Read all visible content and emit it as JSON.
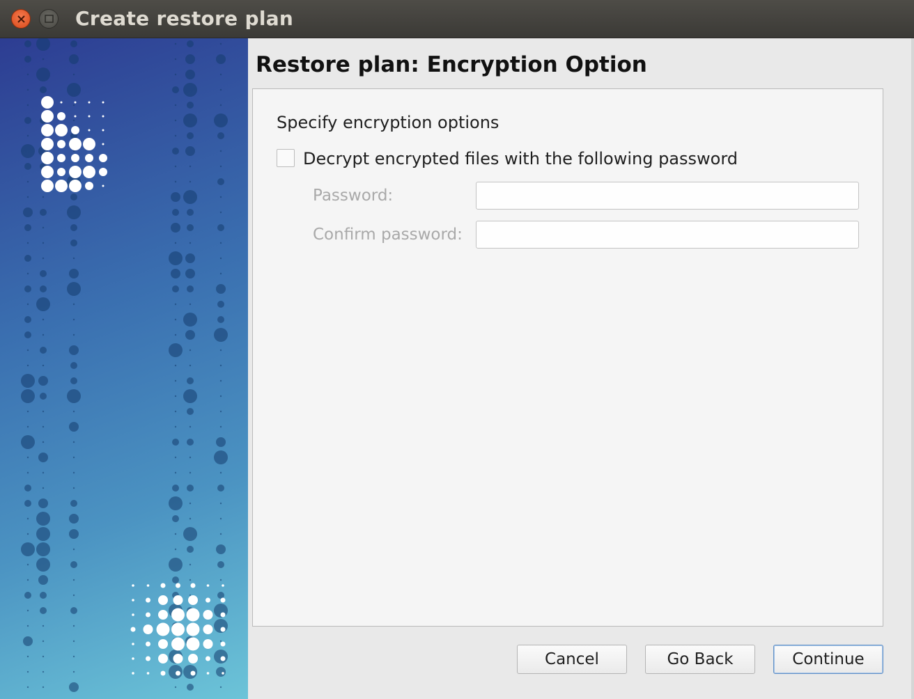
{
  "window": {
    "title": "Create restore plan"
  },
  "content": {
    "heading": "Restore plan: Encryption Option",
    "section_label": "Specify encryption options",
    "decrypt_checkbox": {
      "label": "Decrypt encrypted files with the following password",
      "checked": false
    },
    "password": {
      "label": "Password:",
      "value": ""
    },
    "confirm_password": {
      "label": "Confirm password:",
      "value": ""
    }
  },
  "buttons": {
    "cancel": "Cancel",
    "go_back": "Go Back",
    "continue": "Continue"
  },
  "colors": {
    "close_button": "#e0552a",
    "sidebar_start": "#2d3d92",
    "sidebar_end": "#6cc4d8",
    "primary_border": "#5f8fc6"
  }
}
